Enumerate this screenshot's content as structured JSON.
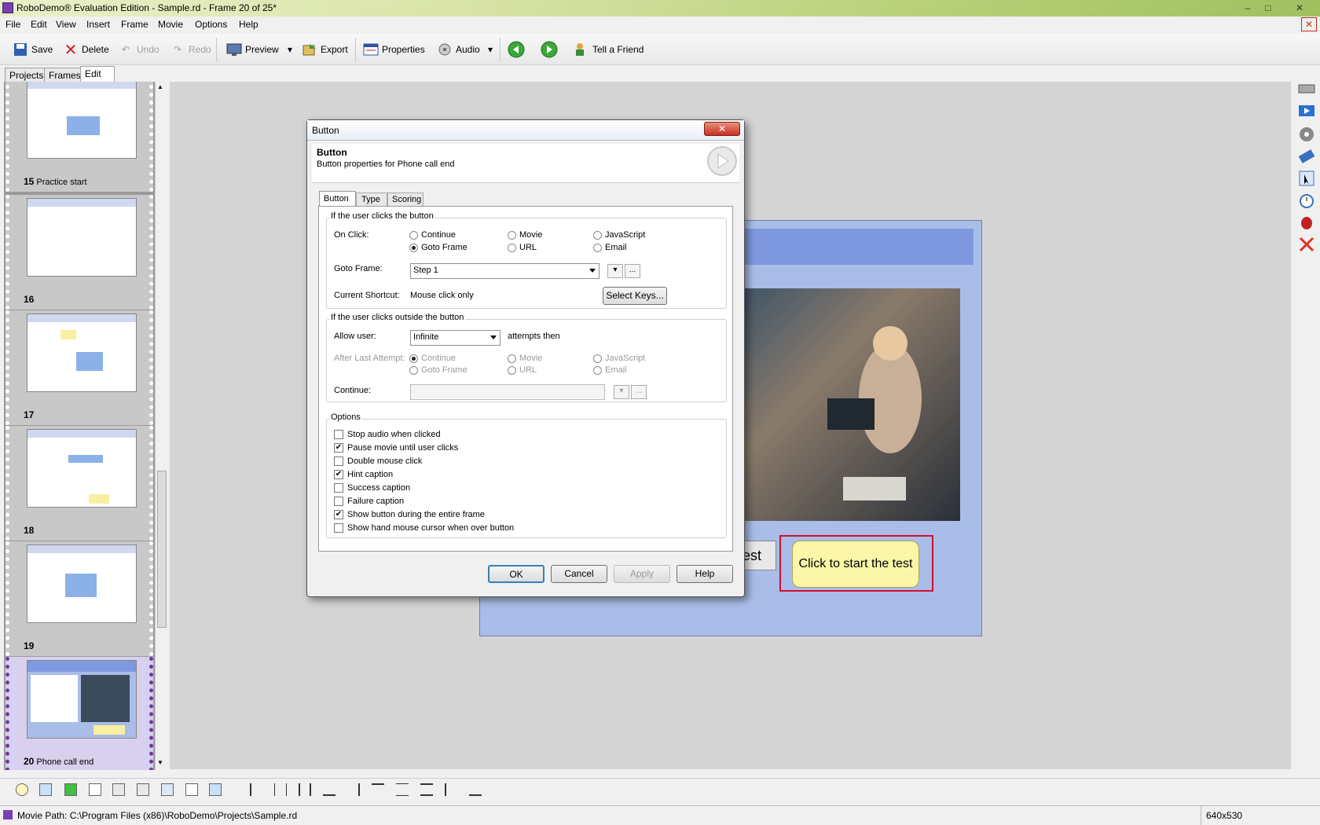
{
  "window": {
    "title": "RoboDemo® Evaluation Edition - Sample.rd - Frame 20 of 25*"
  },
  "menu": [
    "File",
    "Edit",
    "View",
    "Insert",
    "Frame",
    "Movie",
    "Options",
    "Help"
  ],
  "toolbar": {
    "save": "Save",
    "delete": "Delete",
    "undo": "Undo",
    "redo": "Redo",
    "preview": "Preview",
    "export": "Export",
    "properties": "Properties",
    "audio": "Audio",
    "tell_friend": "Tell a Friend"
  },
  "tabs": [
    "Projects",
    "Frames",
    "Edit"
  ],
  "frames": [
    {
      "num": "15",
      "name": "Practice start"
    },
    {
      "num": "16",
      "name": ""
    },
    {
      "num": "17",
      "name": ""
    },
    {
      "num": "18",
      "name": ""
    },
    {
      "num": "19",
      "name": ""
    },
    {
      "num": "20",
      "name": "Phone call end"
    }
  ],
  "stage": {
    "button_text": "est",
    "callout_text": "Click to start the test"
  },
  "dialog": {
    "title": "Button",
    "header_title": "Button",
    "header_sub": "Button properties for Phone call end",
    "tabs": [
      "Button",
      "Type",
      "Scoring"
    ],
    "group1": "If the user clicks the button",
    "on_click_label": "On Click:",
    "on_click_opts": [
      "Continue",
      "Goto Frame",
      "Movie",
      "URL",
      "JavaScript",
      "Email"
    ],
    "goto_frame_label": "Goto Frame:",
    "goto_frame_value": "Step 1",
    "shortcut_label": "Current Shortcut:",
    "shortcut_value": "Mouse click only",
    "select_keys": "Select Keys...",
    "group2": "If the user clicks outside the button",
    "allow_user_label": "Allow user:",
    "allow_user_value": "Infinite",
    "attempts_then": "attempts then",
    "after_last_label": "After Last Attempt:",
    "after_opts": [
      "Continue",
      "Goto Frame",
      "Movie",
      "URL",
      "JavaScript",
      "Email"
    ],
    "continue_label": "Continue:",
    "group3": "Options",
    "options": [
      {
        "label": "Stop audio when clicked",
        "checked": false
      },
      {
        "label": "Pause movie until user clicks",
        "checked": true
      },
      {
        "label": "Double mouse click",
        "checked": false
      },
      {
        "label": "Hint caption",
        "checked": true
      },
      {
        "label": "Success caption",
        "checked": false
      },
      {
        "label": "Failure caption",
        "checked": false
      },
      {
        "label": "Show button during the entire frame",
        "checked": true
      },
      {
        "label": "Show hand mouse cursor when over button",
        "checked": false
      }
    ],
    "ok": "OK",
    "cancel": "Cancel",
    "apply": "Apply",
    "help": "Help",
    "ellipsis": "..."
  },
  "status": {
    "path": "Movie Path: C:\\Program Files (x86)\\RoboDemo\\Projects\\Sample.rd",
    "size": "640x530"
  }
}
